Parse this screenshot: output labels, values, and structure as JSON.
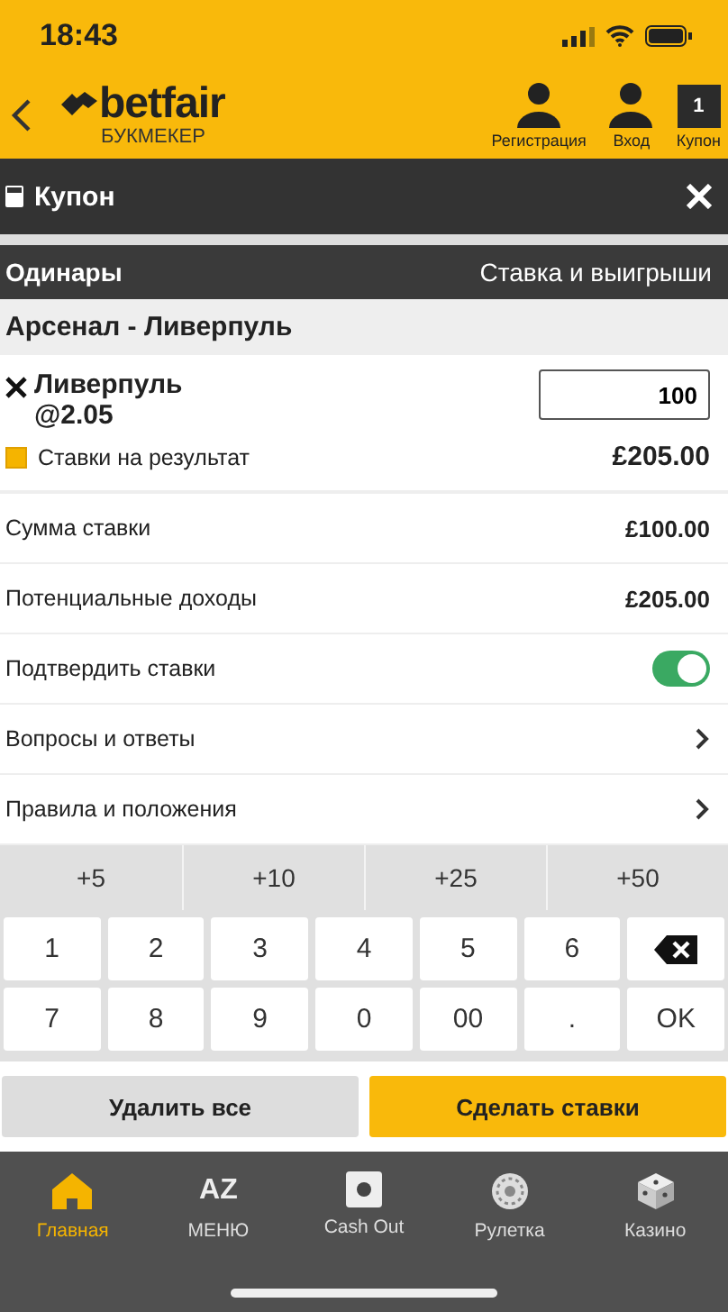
{
  "status_bar": {
    "time": "18:43"
  },
  "header": {
    "logo": {
      "name": "betfair",
      "tagline": "БУКМЕКЕР"
    },
    "actions": [
      {
        "kind": "person",
        "label": "Регистрация"
      },
      {
        "kind": "person",
        "label": "Вход"
      },
      {
        "kind": "count",
        "label": "Купон",
        "count": "1"
      }
    ]
  },
  "coupon_bar": {
    "title": "Купон"
  },
  "section": {
    "left": "Одинары",
    "right": "Ставка и выигрыши"
  },
  "event": {
    "title": "Арсенал - Ливерпуль"
  },
  "selection": {
    "name": "Ливерпуль",
    "odds": "@2.05",
    "stake": "100",
    "market": "Ставки на результат",
    "returns": "£205.00"
  },
  "rows": [
    {
      "kind": "value",
      "label": "Сумма ставки",
      "value": "£100.00"
    },
    {
      "kind": "value",
      "label": "Потенциальные доходы",
      "value": "£205.00"
    },
    {
      "kind": "toggle",
      "label": "Подтвердить ставки",
      "on": true
    },
    {
      "kind": "link",
      "label": "Вопросы и ответы"
    },
    {
      "kind": "link",
      "label": "Правила и положения"
    }
  ],
  "quick_stakes": [
    "+5",
    "+10",
    "+25",
    "+50"
  ],
  "keypad": [
    {
      "kind": "key",
      "label": "1"
    },
    {
      "kind": "key",
      "label": "2"
    },
    {
      "kind": "key",
      "label": "3"
    },
    {
      "kind": "key",
      "label": "4"
    },
    {
      "kind": "key",
      "label": "5"
    },
    {
      "kind": "key",
      "label": "6"
    },
    {
      "kind": "backspace"
    },
    {
      "kind": "key",
      "label": "7"
    },
    {
      "kind": "key",
      "label": "8"
    },
    {
      "kind": "key",
      "label": "9"
    },
    {
      "kind": "key",
      "label": "0"
    },
    {
      "kind": "key",
      "label": "00"
    },
    {
      "kind": "key",
      "label": "."
    },
    {
      "kind": "key",
      "label": "OK"
    }
  ],
  "buttons": [
    {
      "kind": "secondary",
      "label": "Удалить все"
    },
    {
      "kind": "primary",
      "label": "Сделать ставки"
    }
  ],
  "bottom_nav": [
    {
      "kind": "house",
      "label": "Главная",
      "selected": true
    },
    {
      "kind": "letters",
      "glyph": "AZ",
      "label": "МЕНЮ",
      "selected": false
    },
    {
      "kind": "square",
      "label": "Cash Out",
      "selected": false
    },
    {
      "kind": "wheel",
      "label": "Рулетка",
      "selected": false
    },
    {
      "kind": "dice",
      "label": "Казино",
      "selected": false
    }
  ]
}
